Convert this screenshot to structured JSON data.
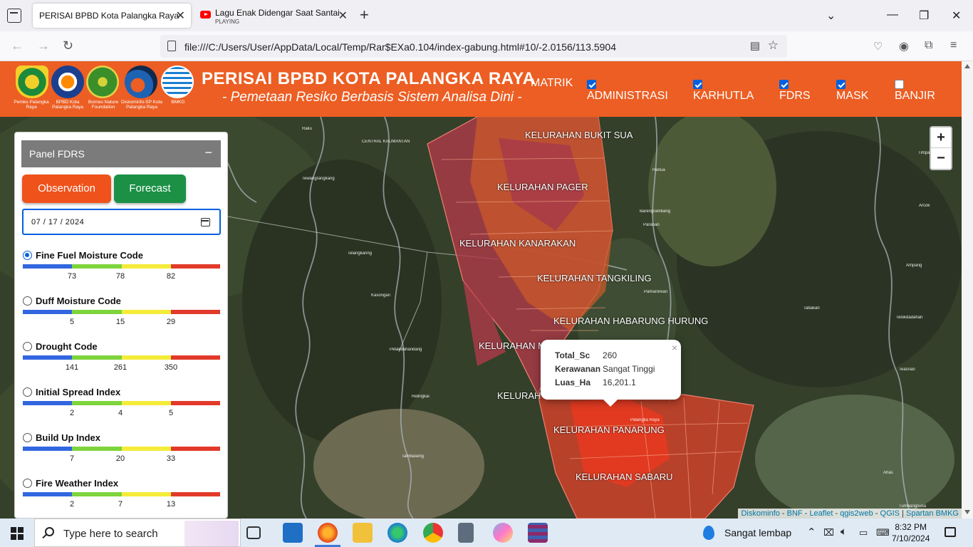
{
  "browser": {
    "tabs": [
      {
        "title": "PERISAI BPBD Kota Palangka Raya",
        "active": true
      },
      {
        "title": "Lagu Enak Didengar Saat Santai",
        "status": "PLAYING",
        "active": false
      }
    ],
    "url": "file:///C:/Users/User/AppData/Local/Temp/Rar$EXa0.104/index-gabung.html#10/-2.0156/113.5904"
  },
  "header": {
    "logos": [
      {
        "caption": "Pemko Palangka Raya"
      },
      {
        "caption": "BPBD Kota Palangka Raya"
      },
      {
        "caption": "Borneo Nature Foundation"
      },
      {
        "caption": "Diskominfo-SP Kota Palangka Raya"
      },
      {
        "caption": "BMKG"
      }
    ],
    "title": "PERISAI BPBD KOTA PALANGKA RAYA",
    "subtitle": "- Pemetaan Resiko Berbasis Sistem Analisa Dini -",
    "menu_label": "MATRIK",
    "layers": [
      {
        "label": "ADMINISTRASI",
        "checked": true
      },
      {
        "label": "KARHUTLA",
        "checked": true
      },
      {
        "label": "FDRS",
        "checked": true
      },
      {
        "label": "MASK",
        "checked": true
      },
      {
        "label": "BANJIR",
        "checked": false
      }
    ]
  },
  "panel": {
    "title": "Panel FDRS",
    "collapse_symbol": "−",
    "observation_label": "Observation",
    "forecast_label": "Forecast",
    "date_value": "07 / 17 / 2024",
    "indices": [
      {
        "name": "Fine Fuel Moisture Code",
        "selected": true,
        "ticks": [
          "73",
          "78",
          "82"
        ]
      },
      {
        "name": "Duff Moisture Code",
        "selected": false,
        "ticks": [
          "5",
          "15",
          "29"
        ]
      },
      {
        "name": "Drought Code",
        "selected": false,
        "ticks": [
          "141",
          "261",
          "350"
        ]
      },
      {
        "name": "Initial Spread Index",
        "selected": false,
        "ticks": [
          "2",
          "4",
          "5"
        ]
      },
      {
        "name": "Build Up Index",
        "selected": false,
        "ticks": [
          "7",
          "20",
          "33"
        ]
      },
      {
        "name": "Fire Weather Index",
        "selected": false,
        "ticks": [
          "2",
          "7",
          "13"
        ]
      }
    ],
    "scale_colors": [
      "#3266e0",
      "#7ed43c",
      "#f5ec3a",
      "#e23a2a"
    ]
  },
  "map": {
    "kelurahan_labels": [
      "KELURAHAN BUKIT SUA",
      "KELURAHAN PAGER",
      "KELURAHAN KANARAKAN",
      "KELURAHAN TANGKILING",
      "KELURAHAN HABARUNG HURUNG",
      "KELURAHAN M",
      "KELURAH",
      "KELURAHAN PANARUNG",
      "KELURAHAN SABARU"
    ],
    "places": [
      "Raku",
      "CENTRAL KALIMANTAN",
      "Tewangrangkang",
      "Telangkaring",
      "Kasongan",
      "Petakbahandang",
      "Relingkai",
      "Tambaseng",
      "Hanua",
      "Parahan",
      "Barengrambang",
      "Pamarorean",
      "Tabakan",
      "Tumbangnusa",
      "Timpah",
      "Arcok",
      "Ampang",
      "Telokdadahan",
      "Teasnan",
      "Ahas",
      "Palangka Raya"
    ],
    "zoom_in": "+",
    "zoom_out": "−",
    "popup": {
      "close": "×",
      "rows": [
        {
          "key": "Total_Sc",
          "value": "260"
        },
        {
          "key": "Kerawanan",
          "value": "Sangat Tinggi"
        },
        {
          "key": "Luas_Ha",
          "value": "16,201.1"
        }
      ]
    },
    "attribution": [
      "Diskominfo",
      "BNF",
      "Leaflet",
      "qgis2web",
      "QGIS",
      "Spartan BMKG"
    ]
  },
  "taskbar": {
    "search_placeholder": "Type here to search",
    "weather": "Sangat lembap",
    "time": "8:32 PM",
    "date": "7/10/2024"
  }
}
